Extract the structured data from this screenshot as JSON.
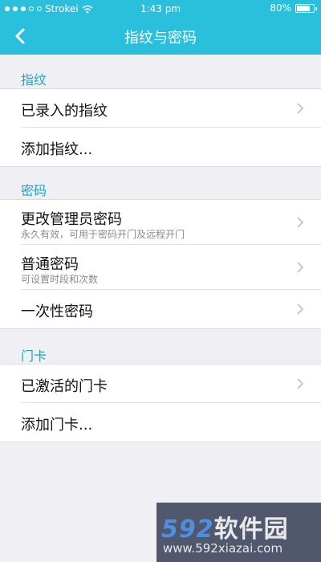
{
  "status_bar": {
    "carrier": "Strokei",
    "time": "1:43 pm",
    "battery": "80%",
    "battery_level": 0.8
  },
  "nav": {
    "title": "指纹与密码",
    "back_icon": "chevron-left-icon"
  },
  "sections": [
    {
      "header": "指纹",
      "items": [
        {
          "title": "已录入的指纹",
          "has_chevron": true
        },
        {
          "title": "添加指纹..."
        }
      ]
    },
    {
      "header": "密码",
      "items": [
        {
          "title": "更改管理员密码",
          "subtitle": "永久有效，可用于密码开门及远程开门",
          "has_chevron": true
        },
        {
          "title": "普通密码",
          "subtitle": "可设置时段和次数",
          "has_chevron": true
        },
        {
          "title": "一次性密码",
          "has_chevron": true
        }
      ]
    },
    {
      "header": "门卡",
      "items": [
        {
          "title": "已激活的门卡",
          "has_chevron": true
        },
        {
          "title": "添加门卡..."
        }
      ]
    }
  ],
  "watermark": {
    "logo": "592软件园",
    "logo_num": "592",
    "logo_cn": "软件园",
    "url": "www.592xiazai.com"
  },
  "colors": {
    "accent": "#29bfdd",
    "section_header": "#1aa5c7",
    "background": "#efeff4"
  }
}
